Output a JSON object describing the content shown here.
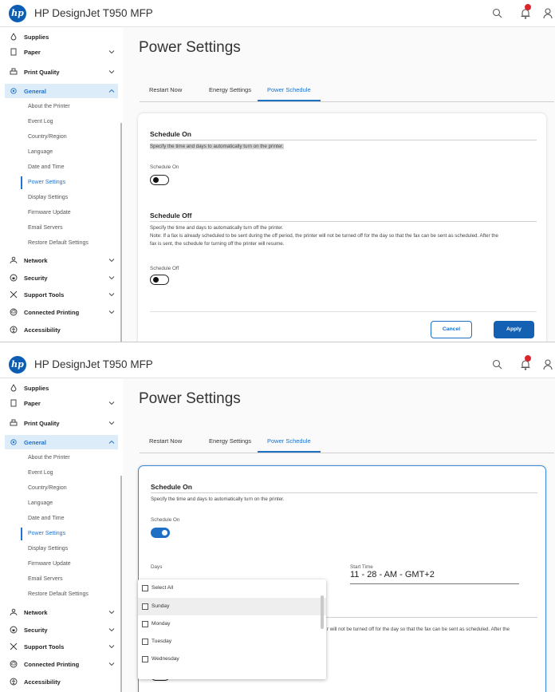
{
  "app": {
    "logo_text": "hp",
    "title": "HP DesignJet T950 MFP"
  },
  "sidebar": {
    "items": [
      {
        "label": "Supplies",
        "icon": "drop-icon"
      },
      {
        "label": "Paper",
        "icon": "paper-icon"
      },
      {
        "label": "Print Quality",
        "icon": "printer-icon"
      },
      {
        "label": "General",
        "icon": "gear-icon"
      },
      {
        "label": "Network",
        "icon": "network-icon"
      },
      {
        "label": "Security",
        "icon": "lock-icon"
      },
      {
        "label": "Support Tools",
        "icon": "tools-icon"
      },
      {
        "label": "Connected Printing",
        "icon": "cloud-icon"
      },
      {
        "label": "Accessibility",
        "icon": "accessibility-icon"
      }
    ],
    "general_subitems": [
      "About the Printer",
      "Event Log",
      "Country/Region",
      "Language",
      "Date and Time",
      "Power Settings",
      "Display Settings",
      "Firmware Update",
      "Email Servers",
      "Restore Default Settings"
    ]
  },
  "page": {
    "title": "Power Settings"
  },
  "tabs": [
    "Restart Now",
    "Energy Settings",
    "Power Schedule"
  ],
  "schedule_on": {
    "title": "Schedule On",
    "description": "Specify the time and days to automatically turn on the printer.",
    "toggle_label": "Schedule On"
  },
  "schedule_off": {
    "title": "Schedule Off",
    "description_1": "Specify the time and days to automatically turn off the printer.",
    "description_2": "Note: If a fax is already scheduled to be sent during the off period, the printer will not be turned off for the day so that the fax can be sent as scheduled. After the",
    "description_3": "fax is sent, the schedule for turning off the printer will resume.",
    "toggle_label": "Schedule Off",
    "partial_note": "r will not be turned off for the day so that the fax can be sent as scheduled. After the"
  },
  "buttons": {
    "cancel": "Cancel",
    "apply": "Apply"
  },
  "days": {
    "label": "Days",
    "options": [
      "Select All",
      "Sunday",
      "Monday",
      "Tuesday",
      "Wednesday"
    ]
  },
  "start_time": {
    "label": "Start Time",
    "value": "11 - 28 - AM - GMT+2"
  },
  "states": {
    "schedule_on_panel_a": false,
    "schedule_on_panel_b": true
  },
  "colors": {
    "accent": "#1f6fc5",
    "apply": "#1461b4",
    "nav_active_bg": "#dcecf9",
    "badge": "#d7262e"
  }
}
